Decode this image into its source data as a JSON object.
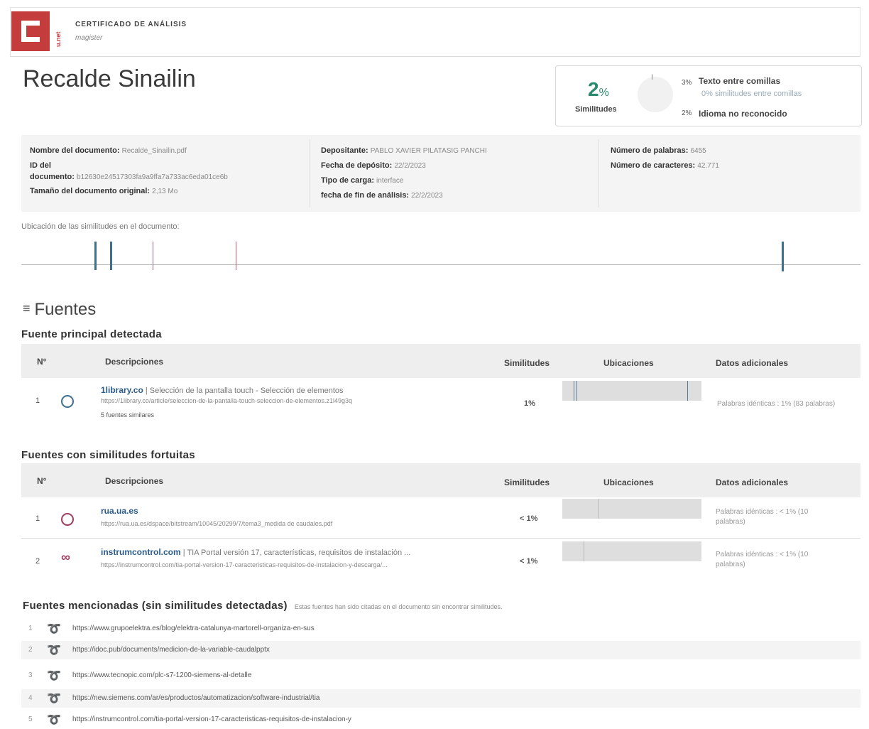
{
  "header": {
    "logo_text": "C",
    "side_text": "u.net",
    "cert_title": "CERTIFICADO DE ANÁLISIS",
    "cert_sub": "magister"
  },
  "document_title": "Recalde Sinailin",
  "summary": {
    "pct_value": "2",
    "pct_unit": "%",
    "pct_label": "Similitudes",
    "donut_mark": "I",
    "quote_pct": "3%",
    "quote_label": "Texto entre comillas",
    "quote_sub": "0% similitudes entre comillas",
    "lang_pct": "2%",
    "lang_label": "Idioma no reconocido"
  },
  "info": {
    "col1": {
      "name_label": "Nombre del documento:",
      "name_value": "Recalde_Sinailin.pdf",
      "id_label_1": "ID del",
      "id_label_2": "documento:",
      "id_value": "b12630e24517303fa9a9ffa7a733ac6eda01ce6b",
      "size_label": "Tamaño del documento original:",
      "size_value": "2,13 Mo"
    },
    "col2": {
      "dep_label": "Depositante:",
      "dep_value": "PABLO XAVIER PILATASIG PANCHI",
      "date_label": "Fecha de depósito:",
      "date_value": "22/2/2023",
      "type_label": "Tipo de carga:",
      "type_value": "interface",
      "end_label": "fecha de fin de análisis:",
      "end_value": "22/2/2023"
    },
    "col3": {
      "words_label": "Número de palabras:",
      "words_value": "6455",
      "chars_label": "Número de caracteres:",
      "chars_value": "42.771"
    }
  },
  "location_label": "Ubicación de las similitudes en el documento:",
  "fuentes_title": "Fuentes",
  "fuentes_icon": "≡",
  "principal": {
    "title": "Fuente principal detectada",
    "headers": {
      "n": "N°",
      "desc": "Descripciones",
      "sim": "Similitudes",
      "loc": "Ubicaciones",
      "data": "Datos adicionales"
    },
    "rows": [
      {
        "n": "1",
        "site": "1library.co",
        "title": " | Selección de la pantalla touch - Selección de elementos",
        "url": "https://1library.co/article/seleccion-de-la-pantalla-touch-seleccion-de-elementos.z1l49g3q",
        "extra": "5 fuentes similares",
        "sim": "1%",
        "data": "Palabras idénticas : 1% (83 palabras)"
      }
    ]
  },
  "fortuitas": {
    "title": "Fuentes con similitudes fortuitas",
    "headers": {
      "n": "N°",
      "desc": "Descripciones",
      "sim": "Similitudes",
      "loc": "Ubicaciones",
      "data": "Datos adicionales"
    },
    "rows": [
      {
        "n": "1",
        "site": "rua.ua.es",
        "title": "",
        "url": "https://rua.ua.es/dspace/bitstream/10045/20299/7/tema3_medida de caudales.pdf",
        "sim": "< 1%",
        "data1": "Palabras idénticas : < 1% (10",
        "data2": "palabras)"
      },
      {
        "n": "2",
        "site": "instrumcontrol.com",
        "title": " | TIA Portal versión 17, características, requisitos de instalación ...",
        "url": "https://instrumcontrol.com/tia-portal-version-17-caracteristicas-requisitos-de-instalacion-y-descarga/...",
        "sim": "< 1%",
        "data1": "Palabras idénticas : < 1% (10",
        "data2": "palabras)"
      }
    ]
  },
  "mencionadas": {
    "title": "Fuentes mencionadas (sin similitudes detectadas)",
    "note": "Estas fuentes han sido citadas en el documento sin encontrar similitudes.",
    "icon": "➰",
    "rows": [
      {
        "n": "1",
        "url": "https://www.grupoelektra.es/blog/elektra-catalunya-martorell-organiza-en-sus"
      },
      {
        "n": "2",
        "url": "https://idoc.pub/documents/medicion-de-la-variable-caudalpptx"
      },
      {
        "n": "3",
        "url": "https://www.tecnopic.com/plc-s7-1200-siemens-al-detalle"
      },
      {
        "n": "4",
        "url": "https://new.siemens.com/ar/es/productos/automatizacion/software-industrial/tia"
      },
      {
        "n": "5",
        "url": "https://instrumcontrol.com/tia-portal-version-17-caracteristicas-requisitos-de-instalacion-y"
      }
    ]
  }
}
